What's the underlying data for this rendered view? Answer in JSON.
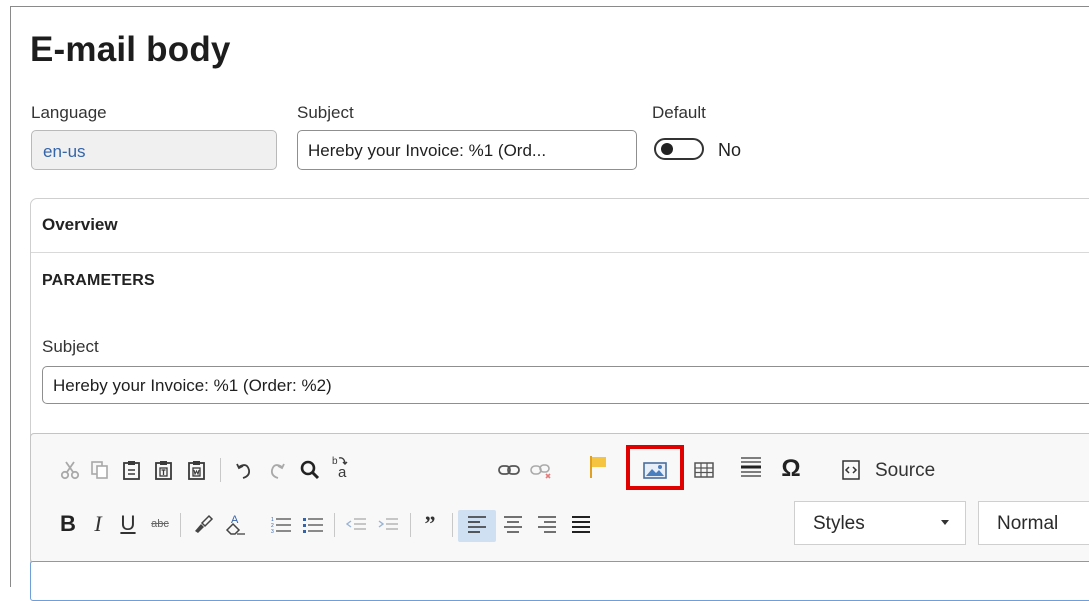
{
  "page": {
    "title": "E-mail body"
  },
  "fields": {
    "language": {
      "label": "Language",
      "value": "en-us"
    },
    "subject": {
      "label": "Subject",
      "value": "Hereby your Invoice: %1 (Ord..."
    },
    "default": {
      "label": "Default",
      "state": "No"
    }
  },
  "overview": {
    "title": "Overview",
    "section": "PARAMETERS",
    "subject_label": "Subject",
    "subject_value": "Hereby your Invoice: %1 (Order: %2)"
  },
  "editor": {
    "toolbar_row1": [
      "cut-icon",
      "copy-icon",
      "paste-icon",
      "paste-text-icon",
      "paste-word-icon",
      "undo-icon",
      "redo-icon",
      "find-icon",
      "replace-icon",
      "link-icon",
      "unlink-icon",
      "anchor-icon",
      "image-icon",
      "table-icon",
      "horizontal-line-icon",
      "special-char-icon",
      "source-icon"
    ],
    "source_label": "Source",
    "styles_label": "Styles",
    "format_label": "Normal",
    "highlight_color": "#e00000",
    "accent_color": "#3464a8"
  }
}
